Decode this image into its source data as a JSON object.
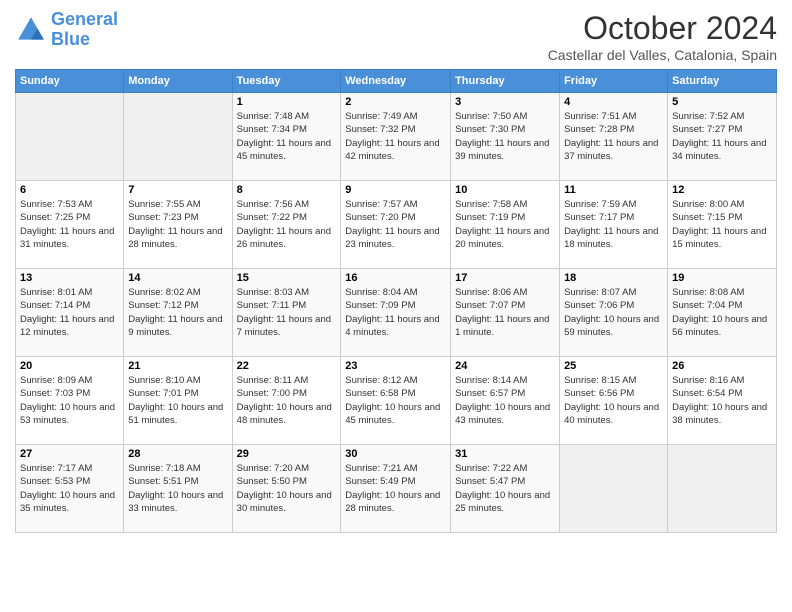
{
  "logo": {
    "line1": "General",
    "line2": "Blue"
  },
  "header": {
    "month": "October 2024",
    "location": "Castellar del Valles, Catalonia, Spain"
  },
  "weekdays": [
    "Sunday",
    "Monday",
    "Tuesday",
    "Wednesday",
    "Thursday",
    "Friday",
    "Saturday"
  ],
  "weeks": [
    [
      {
        "day": "",
        "sunrise": "",
        "sunset": "",
        "daylight": ""
      },
      {
        "day": "",
        "sunrise": "",
        "sunset": "",
        "daylight": ""
      },
      {
        "day": "1",
        "sunrise": "Sunrise: 7:48 AM",
        "sunset": "Sunset: 7:34 PM",
        "daylight": "Daylight: 11 hours and 45 minutes."
      },
      {
        "day": "2",
        "sunrise": "Sunrise: 7:49 AM",
        "sunset": "Sunset: 7:32 PM",
        "daylight": "Daylight: 11 hours and 42 minutes."
      },
      {
        "day": "3",
        "sunrise": "Sunrise: 7:50 AM",
        "sunset": "Sunset: 7:30 PM",
        "daylight": "Daylight: 11 hours and 39 minutes."
      },
      {
        "day": "4",
        "sunrise": "Sunrise: 7:51 AM",
        "sunset": "Sunset: 7:28 PM",
        "daylight": "Daylight: 11 hours and 37 minutes."
      },
      {
        "day": "5",
        "sunrise": "Sunrise: 7:52 AM",
        "sunset": "Sunset: 7:27 PM",
        "daylight": "Daylight: 11 hours and 34 minutes."
      }
    ],
    [
      {
        "day": "6",
        "sunrise": "Sunrise: 7:53 AM",
        "sunset": "Sunset: 7:25 PM",
        "daylight": "Daylight: 11 hours and 31 minutes."
      },
      {
        "day": "7",
        "sunrise": "Sunrise: 7:55 AM",
        "sunset": "Sunset: 7:23 PM",
        "daylight": "Daylight: 11 hours and 28 minutes."
      },
      {
        "day": "8",
        "sunrise": "Sunrise: 7:56 AM",
        "sunset": "Sunset: 7:22 PM",
        "daylight": "Daylight: 11 hours and 26 minutes."
      },
      {
        "day": "9",
        "sunrise": "Sunrise: 7:57 AM",
        "sunset": "Sunset: 7:20 PM",
        "daylight": "Daylight: 11 hours and 23 minutes."
      },
      {
        "day": "10",
        "sunrise": "Sunrise: 7:58 AM",
        "sunset": "Sunset: 7:19 PM",
        "daylight": "Daylight: 11 hours and 20 minutes."
      },
      {
        "day": "11",
        "sunrise": "Sunrise: 7:59 AM",
        "sunset": "Sunset: 7:17 PM",
        "daylight": "Daylight: 11 hours and 18 minutes."
      },
      {
        "day": "12",
        "sunrise": "Sunrise: 8:00 AM",
        "sunset": "Sunset: 7:15 PM",
        "daylight": "Daylight: 11 hours and 15 minutes."
      }
    ],
    [
      {
        "day": "13",
        "sunrise": "Sunrise: 8:01 AM",
        "sunset": "Sunset: 7:14 PM",
        "daylight": "Daylight: 11 hours and 12 minutes."
      },
      {
        "day": "14",
        "sunrise": "Sunrise: 8:02 AM",
        "sunset": "Sunset: 7:12 PM",
        "daylight": "Daylight: 11 hours and 9 minutes."
      },
      {
        "day": "15",
        "sunrise": "Sunrise: 8:03 AM",
        "sunset": "Sunset: 7:11 PM",
        "daylight": "Daylight: 11 hours and 7 minutes."
      },
      {
        "day": "16",
        "sunrise": "Sunrise: 8:04 AM",
        "sunset": "Sunset: 7:09 PM",
        "daylight": "Daylight: 11 hours and 4 minutes."
      },
      {
        "day": "17",
        "sunrise": "Sunrise: 8:06 AM",
        "sunset": "Sunset: 7:07 PM",
        "daylight": "Daylight: 11 hours and 1 minute."
      },
      {
        "day": "18",
        "sunrise": "Sunrise: 8:07 AM",
        "sunset": "Sunset: 7:06 PM",
        "daylight": "Daylight: 10 hours and 59 minutes."
      },
      {
        "day": "19",
        "sunrise": "Sunrise: 8:08 AM",
        "sunset": "Sunset: 7:04 PM",
        "daylight": "Daylight: 10 hours and 56 minutes."
      }
    ],
    [
      {
        "day": "20",
        "sunrise": "Sunrise: 8:09 AM",
        "sunset": "Sunset: 7:03 PM",
        "daylight": "Daylight: 10 hours and 53 minutes."
      },
      {
        "day": "21",
        "sunrise": "Sunrise: 8:10 AM",
        "sunset": "Sunset: 7:01 PM",
        "daylight": "Daylight: 10 hours and 51 minutes."
      },
      {
        "day": "22",
        "sunrise": "Sunrise: 8:11 AM",
        "sunset": "Sunset: 7:00 PM",
        "daylight": "Daylight: 10 hours and 48 minutes."
      },
      {
        "day": "23",
        "sunrise": "Sunrise: 8:12 AM",
        "sunset": "Sunset: 6:58 PM",
        "daylight": "Daylight: 10 hours and 45 minutes."
      },
      {
        "day": "24",
        "sunrise": "Sunrise: 8:14 AM",
        "sunset": "Sunset: 6:57 PM",
        "daylight": "Daylight: 10 hours and 43 minutes."
      },
      {
        "day": "25",
        "sunrise": "Sunrise: 8:15 AM",
        "sunset": "Sunset: 6:56 PM",
        "daylight": "Daylight: 10 hours and 40 minutes."
      },
      {
        "day": "26",
        "sunrise": "Sunrise: 8:16 AM",
        "sunset": "Sunset: 6:54 PM",
        "daylight": "Daylight: 10 hours and 38 minutes."
      }
    ],
    [
      {
        "day": "27",
        "sunrise": "Sunrise: 7:17 AM",
        "sunset": "Sunset: 5:53 PM",
        "daylight": "Daylight: 10 hours and 35 minutes."
      },
      {
        "day": "28",
        "sunrise": "Sunrise: 7:18 AM",
        "sunset": "Sunset: 5:51 PM",
        "daylight": "Daylight: 10 hours and 33 minutes."
      },
      {
        "day": "29",
        "sunrise": "Sunrise: 7:20 AM",
        "sunset": "Sunset: 5:50 PM",
        "daylight": "Daylight: 10 hours and 30 minutes."
      },
      {
        "day": "30",
        "sunrise": "Sunrise: 7:21 AM",
        "sunset": "Sunset: 5:49 PM",
        "daylight": "Daylight: 10 hours and 28 minutes."
      },
      {
        "day": "31",
        "sunrise": "Sunrise: 7:22 AM",
        "sunset": "Sunset: 5:47 PM",
        "daylight": "Daylight: 10 hours and 25 minutes."
      },
      {
        "day": "",
        "sunrise": "",
        "sunset": "",
        "daylight": ""
      },
      {
        "day": "",
        "sunrise": "",
        "sunset": "",
        "daylight": ""
      }
    ]
  ]
}
